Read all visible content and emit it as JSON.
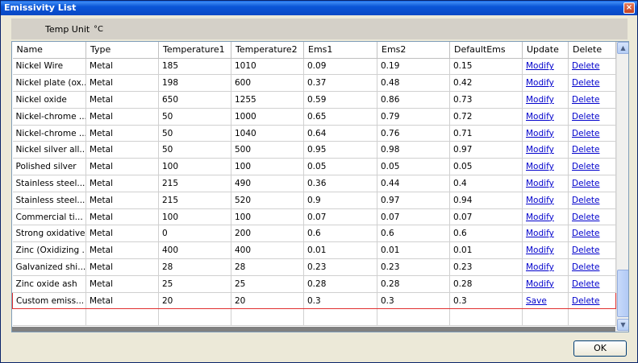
{
  "window": {
    "title": "Emissivity List",
    "close_glyph": "×"
  },
  "unit": {
    "label": "Temp Unit",
    "value": "°C"
  },
  "table": {
    "columns": [
      "Name",
      "Type",
      "Temperature1",
      "Temperature2",
      "Ems1",
      "Ems2",
      "DefaultEms",
      "Update",
      "Delete"
    ],
    "rows": [
      [
        "Nickel Wire",
        "Metal",
        "185",
        "1010",
        "0.09",
        "0.19",
        "0.15",
        "Modify",
        "Delete"
      ],
      [
        "Nickel plate (ox...",
        "Metal",
        "198",
        "600",
        "0.37",
        "0.48",
        "0.42",
        "Modify",
        "Delete"
      ],
      [
        "Nickel oxide",
        "Metal",
        "650",
        "1255",
        "0.59",
        "0.86",
        "0.73",
        "Modify",
        "Delete"
      ],
      [
        "Nickel-chrome ...",
        "Metal",
        "50",
        "1000",
        "0.65",
        "0.79",
        "0.72",
        "Modify",
        "Delete"
      ],
      [
        "Nickel-chrome ...",
        "Metal",
        "50",
        "1040",
        "0.64",
        "0.76",
        "0.71",
        "Modify",
        "Delete"
      ],
      [
        "Nickel silver all...",
        "Metal",
        "50",
        "500",
        "0.95",
        "0.98",
        "0.97",
        "Modify",
        "Delete"
      ],
      [
        "Polished silver",
        "Metal",
        "100",
        "100",
        "0.05",
        "0.05",
        "0.05",
        "Modify",
        "Delete"
      ],
      [
        "Stainless steel...",
        "Metal",
        "215",
        "490",
        "0.36",
        "0.44",
        "0.4",
        "Modify",
        "Delete"
      ],
      [
        "Stainless steel...",
        "Metal",
        "215",
        "520",
        "0.9",
        "0.97",
        "0.94",
        "Modify",
        "Delete"
      ],
      [
        "Commercial ti...",
        "Metal",
        "100",
        "100",
        "0.07",
        "0.07",
        "0.07",
        "Modify",
        "Delete"
      ],
      [
        "Strong oxidative",
        "Metal",
        "0",
        "200",
        "0.6",
        "0.6",
        "0.6",
        "Modify",
        "Delete"
      ],
      [
        "Zinc (Oxidizing ...",
        "Metal",
        "400",
        "400",
        "0.01",
        "0.01",
        "0.01",
        "Modify",
        "Delete"
      ],
      [
        "Galvanized shi...",
        "Metal",
        "28",
        "28",
        "0.23",
        "0.23",
        "0.23",
        "Modify",
        "Delete"
      ],
      [
        "Zinc oxide ash",
        "Metal",
        "25",
        "25",
        "0.28",
        "0.28",
        "0.28",
        "Modify",
        "Delete"
      ],
      [
        "Custom emiss...",
        "Metal",
        "20",
        "20",
        "0.3",
        "0.3",
        "0.3",
        "Save",
        "Delete"
      ]
    ],
    "selected_row": 14
  },
  "buttons": {
    "ok": "OK"
  }
}
